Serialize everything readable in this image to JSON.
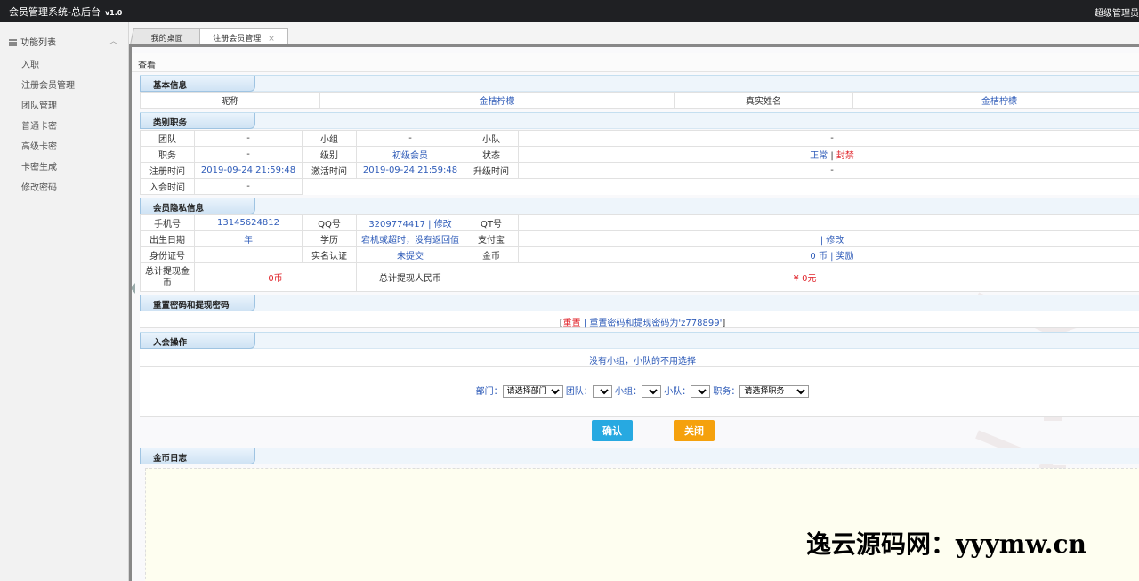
{
  "app": {
    "title": "会员管理系统-总后台",
    "version": "v1.0",
    "user": "超级管理员"
  },
  "sidebar": {
    "header": "功能列表",
    "items": [
      {
        "label": "入职"
      },
      {
        "label": "注册会员管理"
      },
      {
        "label": "团队管理"
      },
      {
        "label": "普通卡密"
      },
      {
        "label": "高级卡密"
      },
      {
        "label": "卡密生成"
      },
      {
        "label": "修改密码"
      }
    ]
  },
  "tabs": [
    {
      "label": "我的桌面"
    },
    {
      "label": "注册会员管理",
      "close": "×"
    }
  ],
  "page": {
    "heading": "查看"
  },
  "basic": {
    "section": "基本信息",
    "nickname_label": "昵称",
    "nickname": "金桔柠檬",
    "realname_label": "真实姓名",
    "realname": "金桔柠檬"
  },
  "category": {
    "section": "类别职务",
    "team_label": "团队",
    "team": "-",
    "group_label": "小组",
    "group": "-",
    "squad_label": "小队",
    "squad": "-",
    "post_label": "职务",
    "post": "-",
    "level_label": "级别",
    "level": "初级会员",
    "status_label": "状态",
    "status_normal": "正常",
    "status_sep": "|",
    "status_ban": "封禁",
    "reg_label": "注册时间",
    "reg_time": "2019-09-24 21:59:48",
    "act_label": "激活时间",
    "act_time": "2019-09-24 21:59:48",
    "up_label": "升级时间",
    "up_time": "-",
    "join_label": "入会时间",
    "join_time": "-"
  },
  "privacy": {
    "section": "会员隐私信息",
    "phone_label": "手机号",
    "phone": "13145624812",
    "qq_label": "QQ号",
    "qq": "3209774417",
    "qq_sep": "|",
    "qq_edit": "修改",
    "qt_label": "QT号",
    "qt": "",
    "birth_label": "出生日期",
    "birth": "年",
    "edu_label": "学历",
    "edu": "宕机或超时，没有返回值",
    "alipay_label": "支付宝",
    "alipay_sep": "|",
    "alipay_edit": "修改",
    "id_label": "身份证号",
    "id": "",
    "realname_auth_label": "实名认证",
    "realname_auth": "未提交",
    "coin_label": "金币",
    "coin": "0 币",
    "coin_sep": "|",
    "coin_reward": "奖励",
    "withdraw_coin_label": "总计提现金币",
    "withdraw_coin": "0币",
    "withdraw_rmb_label": "总计提现人民币",
    "withdraw_rmb": "¥ 0元"
  },
  "reset": {
    "section": "重置密码和提现密码",
    "open": "[",
    "action": "重置",
    "sep": "|",
    "text": "重置密码和提现密码为'z778899'",
    "close": "]"
  },
  "join": {
    "section": "入会操作",
    "notice": "没有小组，小队的不用选择",
    "dept_label": "部门：",
    "dept_value": "请选择部门",
    "team_label": "团队：",
    "group_label": "小组：",
    "squad_label": "小队：",
    "post_label": "职务：",
    "post_value": "请选择职务",
    "confirm": "确认",
    "close": "关闭"
  },
  "coinlog": {
    "section": "金币日志"
  },
  "watermark": "逸云源码网：yyymw.cn"
}
